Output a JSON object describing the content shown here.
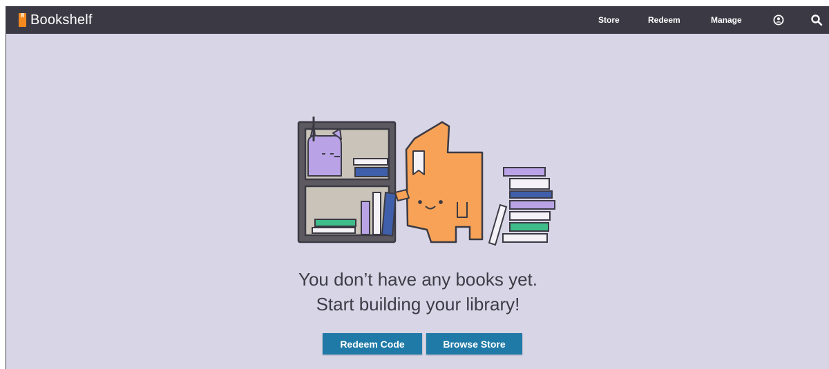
{
  "header": {
    "app_name": "Bookshelf",
    "nav": {
      "store": "Store",
      "redeem": "Redeem",
      "manage": "Manage"
    },
    "icons": {
      "account": "account-icon",
      "search": "search-icon"
    }
  },
  "main": {
    "empty_message_line1": "You don’t have any books yet.",
    "empty_message_line2": "Start building your library!",
    "buttons": {
      "redeem_code": "Redeem Code",
      "browse_store": "Browse Store"
    }
  },
  "colors": {
    "header_bg": "#3b3a44",
    "page_bg": "#d8d6e6",
    "brand_orange": "#f58a1f",
    "button_blue": "#1f7aa8"
  }
}
